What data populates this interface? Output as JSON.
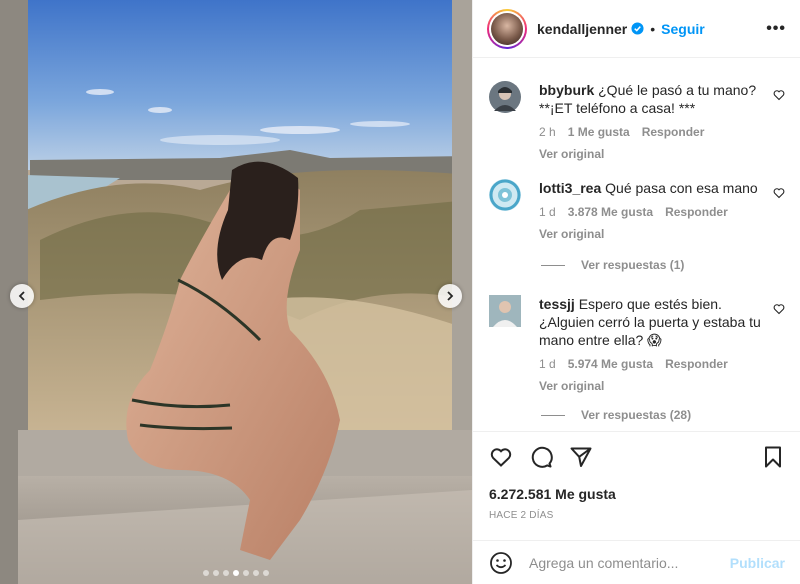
{
  "post": {
    "media_count": 7,
    "media_index": 3
  },
  "header": {
    "username": "kendalljenner",
    "separator": "•",
    "follow_label": "Seguir",
    "more_label": "•••",
    "more_icon": "more-horizontal-icon",
    "verified_icon": "verified-badge-icon"
  },
  "comments": [
    {
      "user": "bbyburk",
      "text": "¿Qué le pasó a tu mano? **¡ET teléfono a casa! ***",
      "time": "2 h",
      "likes": "1 Me gusta",
      "reply": "Responder",
      "original": "Ver original",
      "avatar_color": "#6b7680"
    },
    {
      "user": "lotti3_rea",
      "text": "Qué pasa con esa mano",
      "time": "1 d",
      "likes": "3.878 Me gusta",
      "reply": "Responder",
      "original": "Ver original",
      "replies": "Ver respuestas (1)",
      "avatar_color": "#4aa6c9"
    },
    {
      "user": "tessjj",
      "text": "Espero que estés bien. ¿Alguien cerró la puerta y estaba tu mano entre ella? 😱",
      "time": "1 d",
      "likes": "5.974 Me gusta",
      "reply": "Responder",
      "original": "Ver original",
      "replies": "Ver respuestas (28)",
      "avatar_color": "#8aa0a8"
    }
  ],
  "actions": {
    "like_icon": "heart-icon",
    "comment_icon": "comment-icon",
    "share_icon": "share-icon",
    "save_icon": "bookmark-icon"
  },
  "likes_count": "6.272.581 Me gusta",
  "time_ago": "HACE 2 DÍAS",
  "add_comment": {
    "placeholder": "Agrega un comentario...",
    "publish_label": "Publicar",
    "emoji_icon": "emoji-icon"
  },
  "colors": {
    "accent": "#0095f6",
    "publish_disabled": "#b2dffc",
    "muted": "#8e8e8e"
  }
}
